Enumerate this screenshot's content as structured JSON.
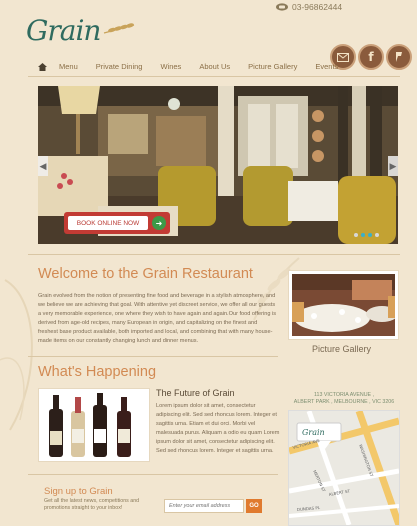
{
  "header": {
    "phone": "03-96862444",
    "brand": "Grain"
  },
  "nav": {
    "items": [
      "Menu",
      "Private Dining",
      "Wines",
      "About Us",
      "Picture Gallery",
      "Events"
    ]
  },
  "social": {
    "icons": [
      "email-icon",
      "facebook-icon",
      "foursquare-icon"
    ]
  },
  "slider": {
    "book_label": "BOOK ONLINE NOW",
    "slides_total": 4,
    "active_slide": 2
  },
  "welcome": {
    "title": "Welcome to the Grain Restaurant",
    "body": "Grain evolved from the notion of presenting fine food and beverage in a stylish atmosphere, and we believe we are achieving that goal. With attentive yet discreet service, we offer all our guests a very memorable experience, one where they wish to have again and again.Our food offering is derived from age-old recipes, many European in origin, and capitalizing on the finest and freshest base product available, both imported and local, and combining that with many house-made items on our constantly changing lunch and dinner menus."
  },
  "gallery": {
    "caption": "Picture Gallery"
  },
  "happening": {
    "title": "What's Happening",
    "news_title": "The Future of Grain",
    "news_body": "Lorem ipsum dolor sit amet, consectetur adipiscing elit. Sed sed rhoncus lorem. Integer et sagittis urna. Etiam et dui orci. Morbi vel malesuada purus. Aliquam a odio eu quam Lorem ipsum dolor sit amet, consectetur adipiscing elit. Sed sed rhoncus lorem. Integer et sagittis urna."
  },
  "address": {
    "line1": "113 VICTORIA AVENUE ,",
    "line2": "ALBERT PARK , MELBOURNE , VIC 3206"
  },
  "map": {
    "streets": [
      "VICTORIA AVE",
      "WASHINGTON ST",
      "MERTON ST",
      "ALBERT ST",
      "DUNDAS PL"
    ]
  },
  "signup": {
    "title": "Sign up to Grain",
    "subtitle": "Get all the latest news, competitions and promotions straight to your inbox!",
    "placeholder": "Enter your email address",
    "go": "GO"
  },
  "colors": {
    "background": "#f2e6d0",
    "heading": "#d28a53",
    "nav": "#8b6f47",
    "logo": "#2f6b5f",
    "book_button": "#c23b34"
  }
}
